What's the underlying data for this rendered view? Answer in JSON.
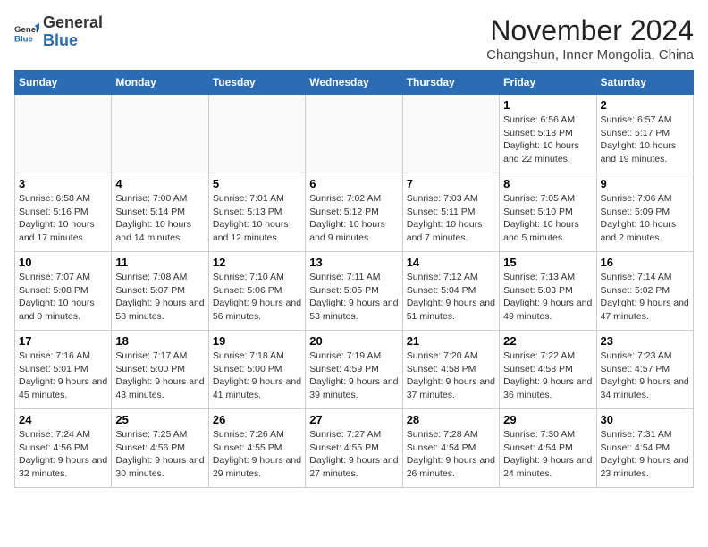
{
  "header": {
    "logo_general": "General",
    "logo_blue": "Blue",
    "month_year": "November 2024",
    "location": "Changshun, Inner Mongolia, China"
  },
  "weekdays": [
    "Sunday",
    "Monday",
    "Tuesday",
    "Wednesday",
    "Thursday",
    "Friday",
    "Saturday"
  ],
  "weeks": [
    [
      {
        "day": "",
        "info": ""
      },
      {
        "day": "",
        "info": ""
      },
      {
        "day": "",
        "info": ""
      },
      {
        "day": "",
        "info": ""
      },
      {
        "day": "",
        "info": ""
      },
      {
        "day": "1",
        "info": "Sunrise: 6:56 AM\nSunset: 5:18 PM\nDaylight: 10 hours and 22 minutes."
      },
      {
        "day": "2",
        "info": "Sunrise: 6:57 AM\nSunset: 5:17 PM\nDaylight: 10 hours and 19 minutes."
      }
    ],
    [
      {
        "day": "3",
        "info": "Sunrise: 6:58 AM\nSunset: 5:16 PM\nDaylight: 10 hours and 17 minutes."
      },
      {
        "day": "4",
        "info": "Sunrise: 7:00 AM\nSunset: 5:14 PM\nDaylight: 10 hours and 14 minutes."
      },
      {
        "day": "5",
        "info": "Sunrise: 7:01 AM\nSunset: 5:13 PM\nDaylight: 10 hours and 12 minutes."
      },
      {
        "day": "6",
        "info": "Sunrise: 7:02 AM\nSunset: 5:12 PM\nDaylight: 10 hours and 9 minutes."
      },
      {
        "day": "7",
        "info": "Sunrise: 7:03 AM\nSunset: 5:11 PM\nDaylight: 10 hours and 7 minutes."
      },
      {
        "day": "8",
        "info": "Sunrise: 7:05 AM\nSunset: 5:10 PM\nDaylight: 10 hours and 5 minutes."
      },
      {
        "day": "9",
        "info": "Sunrise: 7:06 AM\nSunset: 5:09 PM\nDaylight: 10 hours and 2 minutes."
      }
    ],
    [
      {
        "day": "10",
        "info": "Sunrise: 7:07 AM\nSunset: 5:08 PM\nDaylight: 10 hours and 0 minutes."
      },
      {
        "day": "11",
        "info": "Sunrise: 7:08 AM\nSunset: 5:07 PM\nDaylight: 9 hours and 58 minutes."
      },
      {
        "day": "12",
        "info": "Sunrise: 7:10 AM\nSunset: 5:06 PM\nDaylight: 9 hours and 56 minutes."
      },
      {
        "day": "13",
        "info": "Sunrise: 7:11 AM\nSunset: 5:05 PM\nDaylight: 9 hours and 53 minutes."
      },
      {
        "day": "14",
        "info": "Sunrise: 7:12 AM\nSunset: 5:04 PM\nDaylight: 9 hours and 51 minutes."
      },
      {
        "day": "15",
        "info": "Sunrise: 7:13 AM\nSunset: 5:03 PM\nDaylight: 9 hours and 49 minutes."
      },
      {
        "day": "16",
        "info": "Sunrise: 7:14 AM\nSunset: 5:02 PM\nDaylight: 9 hours and 47 minutes."
      }
    ],
    [
      {
        "day": "17",
        "info": "Sunrise: 7:16 AM\nSunset: 5:01 PM\nDaylight: 9 hours and 45 minutes."
      },
      {
        "day": "18",
        "info": "Sunrise: 7:17 AM\nSunset: 5:00 PM\nDaylight: 9 hours and 43 minutes."
      },
      {
        "day": "19",
        "info": "Sunrise: 7:18 AM\nSunset: 5:00 PM\nDaylight: 9 hours and 41 minutes."
      },
      {
        "day": "20",
        "info": "Sunrise: 7:19 AM\nSunset: 4:59 PM\nDaylight: 9 hours and 39 minutes."
      },
      {
        "day": "21",
        "info": "Sunrise: 7:20 AM\nSunset: 4:58 PM\nDaylight: 9 hours and 37 minutes."
      },
      {
        "day": "22",
        "info": "Sunrise: 7:22 AM\nSunset: 4:58 PM\nDaylight: 9 hours and 36 minutes."
      },
      {
        "day": "23",
        "info": "Sunrise: 7:23 AM\nSunset: 4:57 PM\nDaylight: 9 hours and 34 minutes."
      }
    ],
    [
      {
        "day": "24",
        "info": "Sunrise: 7:24 AM\nSunset: 4:56 PM\nDaylight: 9 hours and 32 minutes."
      },
      {
        "day": "25",
        "info": "Sunrise: 7:25 AM\nSunset: 4:56 PM\nDaylight: 9 hours and 30 minutes."
      },
      {
        "day": "26",
        "info": "Sunrise: 7:26 AM\nSunset: 4:55 PM\nDaylight: 9 hours and 29 minutes."
      },
      {
        "day": "27",
        "info": "Sunrise: 7:27 AM\nSunset: 4:55 PM\nDaylight: 9 hours and 27 minutes."
      },
      {
        "day": "28",
        "info": "Sunrise: 7:28 AM\nSunset: 4:54 PM\nDaylight: 9 hours and 26 minutes."
      },
      {
        "day": "29",
        "info": "Sunrise: 7:30 AM\nSunset: 4:54 PM\nDaylight: 9 hours and 24 minutes."
      },
      {
        "day": "30",
        "info": "Sunrise: 7:31 AM\nSunset: 4:54 PM\nDaylight: 9 hours and 23 minutes."
      }
    ]
  ]
}
